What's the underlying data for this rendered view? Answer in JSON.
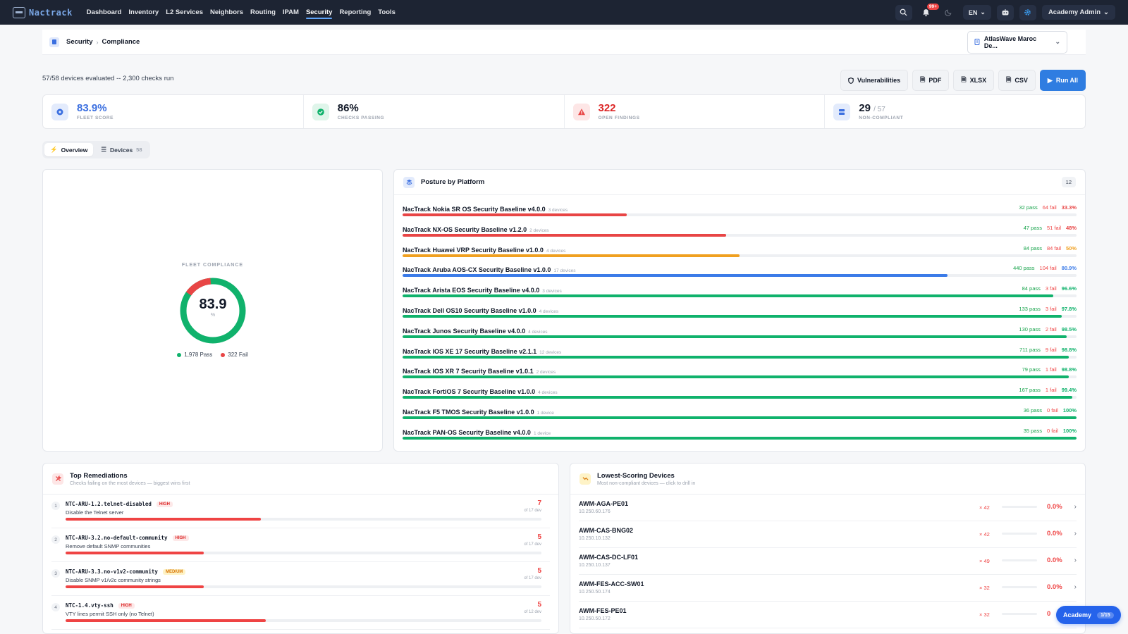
{
  "nav": {
    "logo": "Nactrack",
    "items": [
      "Dashboard",
      "Inventory",
      "L2 Services",
      "Neighbors",
      "Routing",
      "IPAM",
      "Security",
      "Reporting",
      "Tools"
    ],
    "active": "Security",
    "notif_badge": "99+",
    "lang": "EN",
    "user": "Academy Admin"
  },
  "breadcrumb": {
    "parent": "Security",
    "current": "Compliance",
    "site": "AtlasWave Maroc De..."
  },
  "summary": {
    "eval_text": "57/58 devices evaluated -- 2,300 checks run"
  },
  "actions": {
    "vulnerabilities": "Vulnerabilities",
    "pdf": "PDF",
    "xlsx": "XLSX",
    "csv": "CSV",
    "run_all": "Run All"
  },
  "kpis": {
    "fleet_score": {
      "value": "83.9%",
      "label": "FLEET SCORE",
      "color": "#3b6fe0"
    },
    "checks_passing": {
      "value": "86%",
      "label": "CHECKS PASSING",
      "color": "#111827"
    },
    "open_findings": {
      "value": "322",
      "label": "OPEN FINDINGS",
      "color": "#dc2626"
    },
    "non_compliant": {
      "value": "29",
      "total": "/ 57",
      "label": "NON-COMPLIANT",
      "color": "#111827"
    }
  },
  "tabs": {
    "overview": "Overview",
    "devices": "Devices",
    "devices_count": "58"
  },
  "fleet": {
    "title": "FLEET COMPLIANCE",
    "score": "83.9",
    "unit": "%",
    "pass_label": "1,978 Pass",
    "fail_label": "322 Fail",
    "pass": 1978,
    "fail": 322,
    "pass_color": "#10b26c",
    "fail_color": "#e84545"
  },
  "posture": {
    "title": "Posture by Platform",
    "count": "12",
    "rows": [
      {
        "name": "NacTrack Nokia SR OS Security Baseline v4.0.0",
        "devices": "3 devices",
        "pass": "32 pass",
        "fail": "64 fail",
        "pct": "33.3%",
        "value": 33.3,
        "color": "#e84545"
      },
      {
        "name": "NacTrack NX-OS Security Baseline v1.2.0",
        "devices": "2 devices",
        "pass": "47 pass",
        "fail": "51 fail",
        "pct": "48%",
        "value": 48,
        "color": "#e84545"
      },
      {
        "name": "NacTrack Huawei VRP Security Baseline v1.0.0",
        "devices": "4 devices",
        "pass": "84 pass",
        "fail": "84 fail",
        "pct": "50%",
        "value": 50,
        "color": "#f0a020"
      },
      {
        "name": "NacTrack Aruba AOS-CX Security Baseline v1.0.0",
        "devices": "17 devices",
        "pass": "440 pass",
        "fail": "104 fail",
        "pct": "80.9%",
        "value": 80.9,
        "color": "#3b7be8"
      },
      {
        "name": "NacTrack Arista EOS Security Baseline v4.0.0",
        "devices": "3 devices",
        "pass": "84 pass",
        "fail": "3 fail",
        "pct": "96.6%",
        "value": 96.6,
        "color": "#10b26c"
      },
      {
        "name": "NacTrack Dell OS10 Security Baseline v1.0.0",
        "devices": "4 devices",
        "pass": "133 pass",
        "fail": "3 fail",
        "pct": "97.8%",
        "value": 97.8,
        "color": "#10b26c"
      },
      {
        "name": "NacTrack Junos Security Baseline v4.0.0",
        "devices": "4 devices",
        "pass": "130 pass",
        "fail": "2 fail",
        "pct": "98.5%",
        "value": 98.5,
        "color": "#10b26c"
      },
      {
        "name": "NacTrack IOS XE 17 Security Baseline v2.1.1",
        "devices": "12 devices",
        "pass": "711 pass",
        "fail": "9 fail",
        "pct": "98.8%",
        "value": 98.8,
        "color": "#10b26c"
      },
      {
        "name": "NacTrack IOS XR 7 Security Baseline v1.0.1",
        "devices": "2 devices",
        "pass": "79 pass",
        "fail": "1 fail",
        "pct": "98.8%",
        "value": 98.8,
        "color": "#10b26c"
      },
      {
        "name": "NacTrack FortiOS 7 Security Baseline v1.0.0",
        "devices": "4 devices",
        "pass": "167 pass",
        "fail": "1 fail",
        "pct": "99.4%",
        "value": 99.4,
        "color": "#10b26c"
      },
      {
        "name": "NacTrack F5 TMOS Security Baseline v1.0.0",
        "devices": "1 device",
        "pass": "36 pass",
        "fail": "0 fail",
        "pct": "100%",
        "value": 100,
        "color": "#10b26c"
      },
      {
        "name": "NacTrack PAN-OS Security Baseline v4.0.0",
        "devices": "1 device",
        "pass": "35 pass",
        "fail": "0 fail",
        "pct": "100%",
        "value": 100,
        "color": "#10b26c"
      }
    ]
  },
  "remediations": {
    "title": "Top Remediations",
    "subtitle": "Checks failing on the most devices — biggest wins first",
    "rows": [
      {
        "idx": "1",
        "code": "NTC-ARU-1.2.telnet-disabled",
        "sev": "HIGH",
        "desc": "Disable the Telnet server",
        "count": "7",
        "of": "of 17 dev",
        "fraction": 0.41
      },
      {
        "idx": "2",
        "code": "NTC-ARU-3.2.no-default-community",
        "sev": "HIGH",
        "desc": "Remove default SNMP communities",
        "count": "5",
        "of": "of 17 dev",
        "fraction": 0.29
      },
      {
        "idx": "3",
        "code": "NTC-ARU-3.3.no-v1v2-community",
        "sev": "MEDIUM",
        "desc": "Disable SNMP v1/v2c community strings",
        "count": "5",
        "of": "of 17 dev",
        "fraction": 0.29
      },
      {
        "idx": "4",
        "code": "NTC-1.4.vty-ssh",
        "sev": "HIGH",
        "desc": "VTY lines permit SSH only (no Telnet)",
        "count": "5",
        "of": "of 12 dev",
        "fraction": 0.42
      }
    ]
  },
  "lowest": {
    "title": "Lowest-Scoring Devices",
    "subtitle": "Most non-compliant devices — click to drill in",
    "rows": [
      {
        "name": "AWM-AGA-PE01",
        "ip": "10.250.60.176",
        "fails": "× 42",
        "score": "0.0%"
      },
      {
        "name": "AWM-CAS-BNG02",
        "ip": "10.250.10.132",
        "fails": "× 42",
        "score": "0.0%"
      },
      {
        "name": "AWM-CAS-DC-LF01",
        "ip": "10.250.10.137",
        "fails": "× 49",
        "score": "0.0%"
      },
      {
        "name": "AWM-FES-ACC-SW01",
        "ip": "10.250.50.174",
        "fails": "× 32",
        "score": "0.0%"
      },
      {
        "name": "AWM-FES-PE01",
        "ip": "10.250.50.172",
        "fails": "× 32",
        "score": "0"
      }
    ]
  },
  "academy": {
    "label": "Academy",
    "progress": "1/15"
  }
}
